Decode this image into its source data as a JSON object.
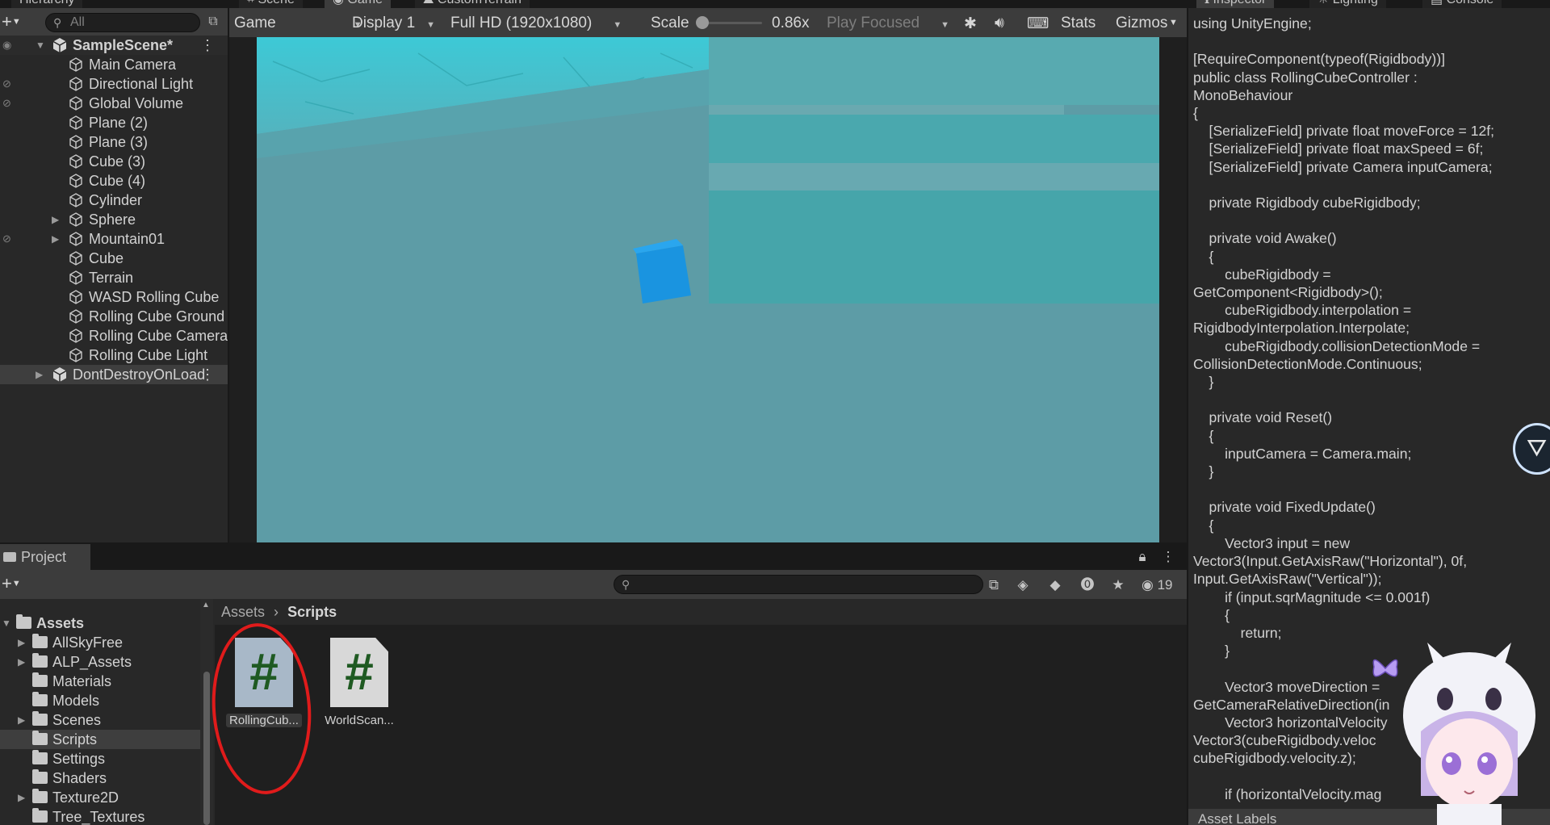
{
  "hierarchy": {
    "tab": "Hierarchy",
    "search_placeholder": "All",
    "scene_name": "SampleScene*",
    "items": [
      "Main Camera",
      "Directional Light",
      "Global Volume",
      "Plane (2)",
      "Plane (3)",
      "Cube (3)",
      "Cube (4)",
      "Cylinder",
      "Sphere",
      "Mountain01",
      "Cube",
      "Terrain",
      "WASD Rolling Cube",
      "Rolling Cube Ground",
      "Rolling Cube Camera",
      "Rolling Cube Light"
    ],
    "dont_destroy": "DontDestroyOnLoad"
  },
  "game": {
    "tabs": [
      "Scene",
      "Game",
      "CustomTerrain"
    ],
    "mode": "Game",
    "display": "Display 1",
    "resolution": "Full HD (1920x1080)",
    "scale_label": "Scale",
    "scale_value": "0.86x",
    "scale_fraction": 0.02,
    "play_focused": "Play Focused",
    "stats": "Stats",
    "gizmos": "Gizmos"
  },
  "inspector": {
    "tabs": [
      "Inspector",
      "Lighting",
      "Console"
    ],
    "code": [
      "using UnityEngine;",
      "",
      "[RequireComponent(typeof(Rigidbody))]",
      "public class RollingCubeController :",
      "MonoBehaviour",
      "{",
      "    [SerializeField] private float moveForce = 12f;",
      "    [SerializeField] private float maxSpeed = 6f;",
      "    [SerializeField] private Camera inputCamera;",
      "",
      "    private Rigidbody cubeRigidbody;",
      "",
      "    private void Awake()",
      "    {",
      "        cubeRigidbody =",
      "GetComponent<Rigidbody>();",
      "        cubeRigidbody.interpolation =",
      "RigidbodyInterpolation.Interpolate;",
      "        cubeRigidbody.collisionDetectionMode =",
      "CollisionDetectionMode.Continuous;",
      "    }",
      "",
      "    private void Reset()",
      "    {",
      "        inputCamera = Camera.main;",
      "    }",
      "",
      "    private void FixedUpdate()",
      "    {",
      "        Vector3 input = new",
      "Vector3(Input.GetAxisRaw(\"Horizontal\"), 0f,",
      "Input.GetAxisRaw(\"Vertical\"));",
      "        if (input.sqrMagnitude <= 0.001f)",
      "        {",
      "            return;",
      "        }",
      "",
      "        Vector3 moveDirection =",
      "GetCameraRelativeDirection(in",
      "        Vector3 horizontalVelocity",
      "Vector3(cubeRigidbody.veloc",
      "cubeRigidbody.velocity.z);",
      "",
      "        if (horizontalVelocity.mag"
    ],
    "asset_labels": "Asset Labels"
  },
  "project": {
    "tab": "Project",
    "hidden_count": "19",
    "folders": [
      {
        "name": "Assets",
        "expandable": true,
        "expanded": true
      },
      {
        "name": "AllSkyFree",
        "expandable": true
      },
      {
        "name": "ALP_Assets",
        "expandable": true
      },
      {
        "name": "Materials",
        "expandable": false
      },
      {
        "name": "Models",
        "expandable": false
      },
      {
        "name": "Scenes",
        "expandable": true
      },
      {
        "name": "Scripts",
        "expandable": false
      },
      {
        "name": "Settings",
        "expandable": false
      },
      {
        "name": "Shaders",
        "expandable": false
      },
      {
        "name": "Texture2D",
        "expandable": true
      },
      {
        "name": "Tree_Textures",
        "expandable": false
      }
    ],
    "breadcrumb": {
      "root": "Assets",
      "separator": "›",
      "current": "Scripts"
    },
    "assets": [
      {
        "name": "RollingCub...",
        "icon": "#"
      },
      {
        "name": "WorldScan...",
        "icon": "#"
      }
    ]
  }
}
